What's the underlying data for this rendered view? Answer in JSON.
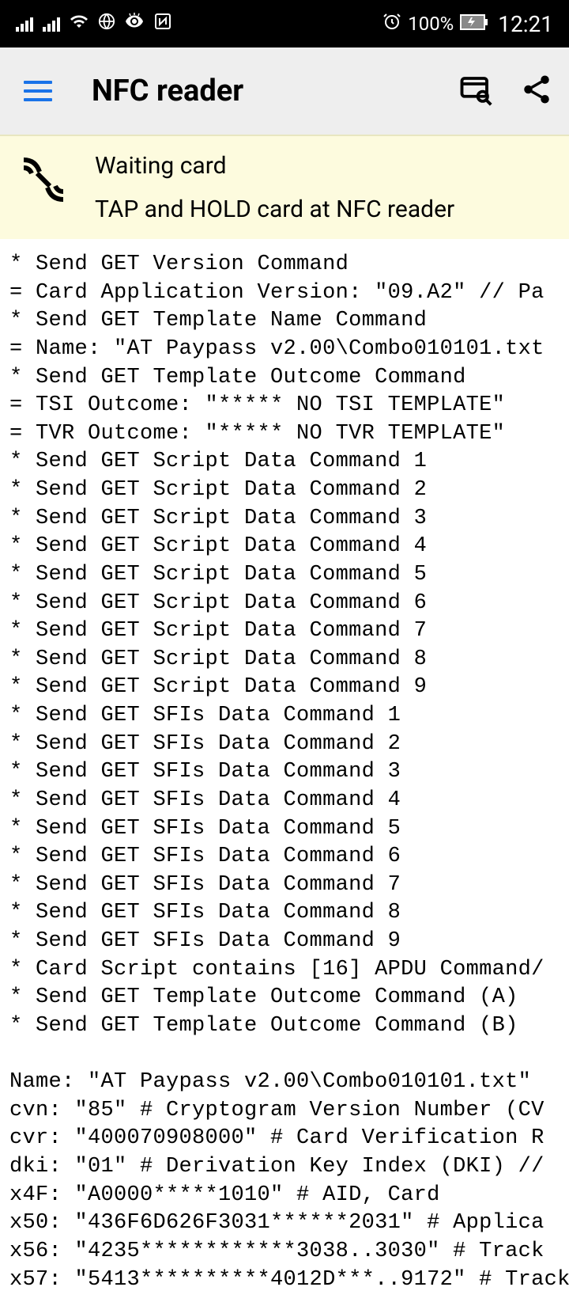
{
  "statusbar": {
    "battery_text": "100%",
    "time": "12:21"
  },
  "appbar": {
    "title": "NFC reader"
  },
  "banner": {
    "title": "Waiting card",
    "subtitle": "TAP and HOLD card at NFC reader"
  },
  "log": {
    "lines": [
      "* Send GET Version Command",
      "= Card Application Version: \"09.A2\" // Pa",
      "* Send GET Template Name Command",
      "= Name: \"AT Paypass v2.00\\Combo010101.txt",
      "* Send GET Template Outcome Command",
      "= TSI Outcome: \"***** NO TSI TEMPLATE\"",
      "= TVR Outcome: \"***** NO TVR TEMPLATE\"",
      "* Send GET Script Data Command 1",
      "* Send GET Script Data Command 2",
      "* Send GET Script Data Command 3",
      "* Send GET Script Data Command 4",
      "* Send GET Script Data Command 5",
      "* Send GET Script Data Command 6",
      "* Send GET Script Data Command 7",
      "* Send GET Script Data Command 8",
      "* Send GET Script Data Command 9",
      "* Send GET SFIs Data Command 1",
      "* Send GET SFIs Data Command 2",
      "* Send GET SFIs Data Command 3",
      "* Send GET SFIs Data Command 4",
      "* Send GET SFIs Data Command 5",
      "* Send GET SFIs Data Command 6",
      "* Send GET SFIs Data Command 7",
      "* Send GET SFIs Data Command 8",
      "* Send GET SFIs Data Command 9",
      "* Card Script contains [16] APDU Command/",
      "* Send GET Template Outcome Command (A)",
      "* Send GET Template Outcome Command (B)",
      "",
      "Name: \"AT Paypass v2.00\\Combo010101.txt\"",
      "cvn: \"85\" # Cryptogram Version Number (CV",
      "cvr: \"400070908000\" # Card Verification R",
      "dki: \"01\" # Derivation Key Index (DKI) //",
      "x4F: \"A0000*****1010\" # AID, Card",
      "x50: \"436F6D626F3031******2031\" # Applica",
      "x56: \"4235************3038..3030\" # Track",
      "x57: \"5413**********4012D***..9172\" # Track"
    ]
  }
}
